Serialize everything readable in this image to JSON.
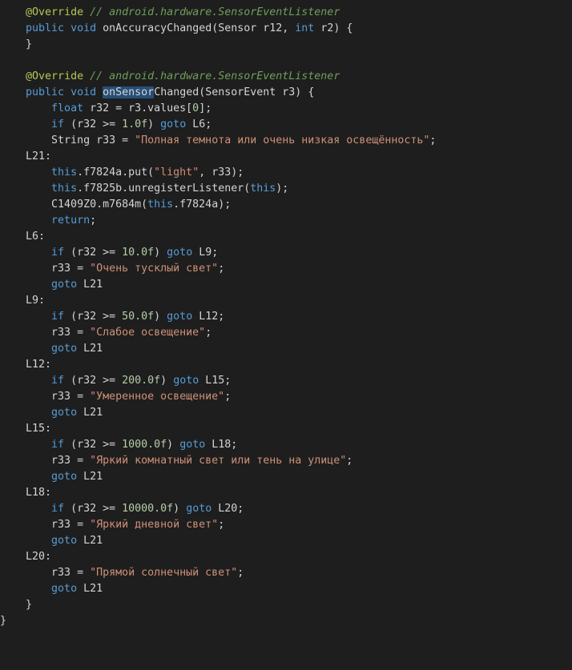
{
  "editor": {
    "theme": {
      "background": "#1e1e1e",
      "keyword": "#569cd6",
      "string": "#ce9178",
      "number": "#b5cea8",
      "comment": "#6f9e5c",
      "annotation": "#b5c953",
      "text": "#d4d4d4",
      "selection": "#264f78"
    },
    "lines": [
      [
        {
          "t": "    "
        },
        {
          "t": "@Override",
          "c": "ann"
        },
        {
          "t": " "
        },
        {
          "t": "// android.hardware.SensorEventListener",
          "c": "cmt"
        }
      ],
      [
        {
          "t": "    "
        },
        {
          "t": "public",
          "c": "kw"
        },
        {
          "t": " "
        },
        {
          "t": "void",
          "c": "kw"
        },
        {
          "t": " onAccuracyChanged(Sensor r12, "
        },
        {
          "t": "int",
          "c": "kw"
        },
        {
          "t": " r2) {"
        }
      ],
      [
        {
          "t": "    }"
        }
      ],
      [
        {
          "t": ""
        }
      ],
      [
        {
          "t": "    "
        },
        {
          "t": "@Override",
          "c": "ann"
        },
        {
          "t": " "
        },
        {
          "t": "// android.hardware.SensorEventListener",
          "c": "cmt"
        }
      ],
      [
        {
          "t": "    "
        },
        {
          "t": "public",
          "c": "kw"
        },
        {
          "t": " "
        },
        {
          "t": "void",
          "c": "kw"
        },
        {
          "t": " "
        },
        {
          "t": "onSensor",
          "c": "sel"
        },
        {
          "t": "Changed(SensorEvent r3) {"
        }
      ],
      [
        {
          "t": "        "
        },
        {
          "t": "float",
          "c": "kw"
        },
        {
          "t": " r32 = r3.values["
        },
        {
          "t": "0",
          "c": "num"
        },
        {
          "t": "];"
        }
      ],
      [
        {
          "t": "        "
        },
        {
          "t": "if",
          "c": "kw"
        },
        {
          "t": " (r32 >= "
        },
        {
          "t": "1.0f",
          "c": "num"
        },
        {
          "t": ") "
        },
        {
          "t": "goto",
          "c": "kw"
        },
        {
          "t": " L6;"
        }
      ],
      [
        {
          "t": "        String r33 = "
        },
        {
          "t": "\"Полная темнота или очень низкая освещённость\"",
          "c": "str"
        },
        {
          "t": ";"
        }
      ],
      [
        {
          "t": "    L21:"
        }
      ],
      [
        {
          "t": "        "
        },
        {
          "t": "this",
          "c": "kw"
        },
        {
          "t": ".f7824a.put("
        },
        {
          "t": "\"light\"",
          "c": "str"
        },
        {
          "t": ", r33);"
        }
      ],
      [
        {
          "t": "        "
        },
        {
          "t": "this",
          "c": "kw"
        },
        {
          "t": ".f7825b.unregisterListener("
        },
        {
          "t": "this",
          "c": "kw"
        },
        {
          "t": ");"
        }
      ],
      [
        {
          "t": "        C1409Z0.m7684m("
        },
        {
          "t": "this",
          "c": "kw"
        },
        {
          "t": ".f7824a);"
        }
      ],
      [
        {
          "t": "        "
        },
        {
          "t": "return",
          "c": "kw"
        },
        {
          "t": ";"
        }
      ],
      [
        {
          "t": "    L6:"
        }
      ],
      [
        {
          "t": "        "
        },
        {
          "t": "if",
          "c": "kw"
        },
        {
          "t": " (r32 >= "
        },
        {
          "t": "10.0f",
          "c": "num"
        },
        {
          "t": ") "
        },
        {
          "t": "goto",
          "c": "kw"
        },
        {
          "t": " L9;"
        }
      ],
      [
        {
          "t": "        r33 = "
        },
        {
          "t": "\"Очень тусклый свет\"",
          "c": "str"
        },
        {
          "t": ";"
        }
      ],
      [
        {
          "t": "        "
        },
        {
          "t": "goto",
          "c": "kw"
        },
        {
          "t": " L21"
        }
      ],
      [
        {
          "t": "    L9:"
        }
      ],
      [
        {
          "t": "        "
        },
        {
          "t": "if",
          "c": "kw"
        },
        {
          "t": " (r32 >= "
        },
        {
          "t": "50.0f",
          "c": "num"
        },
        {
          "t": ") "
        },
        {
          "t": "goto",
          "c": "kw"
        },
        {
          "t": " L12;"
        }
      ],
      [
        {
          "t": "        r33 = "
        },
        {
          "t": "\"Слабое освещение\"",
          "c": "str"
        },
        {
          "t": ";"
        }
      ],
      [
        {
          "t": "        "
        },
        {
          "t": "goto",
          "c": "kw"
        },
        {
          "t": " L21"
        }
      ],
      [
        {
          "t": "    L12:"
        }
      ],
      [
        {
          "t": "        "
        },
        {
          "t": "if",
          "c": "kw"
        },
        {
          "t": " (r32 >= "
        },
        {
          "t": "200.0f",
          "c": "num"
        },
        {
          "t": ") "
        },
        {
          "t": "goto",
          "c": "kw"
        },
        {
          "t": " L15;"
        }
      ],
      [
        {
          "t": "        r33 = "
        },
        {
          "t": "\"Умеренное освещение\"",
          "c": "str"
        },
        {
          "t": ";"
        }
      ],
      [
        {
          "t": "        "
        },
        {
          "t": "goto",
          "c": "kw"
        },
        {
          "t": " L21"
        }
      ],
      [
        {
          "t": "    L15:"
        }
      ],
      [
        {
          "t": "        "
        },
        {
          "t": "if",
          "c": "kw"
        },
        {
          "t": " (r32 >= "
        },
        {
          "t": "1000.0f",
          "c": "num"
        },
        {
          "t": ") "
        },
        {
          "t": "goto",
          "c": "kw"
        },
        {
          "t": " L18;"
        }
      ],
      [
        {
          "t": "        r33 = "
        },
        {
          "t": "\"Яркий комнатный свет или тень на улице\"",
          "c": "str"
        },
        {
          "t": ";"
        }
      ],
      [
        {
          "t": "        "
        },
        {
          "t": "goto",
          "c": "kw"
        },
        {
          "t": " L21"
        }
      ],
      [
        {
          "t": "    L18:"
        }
      ],
      [
        {
          "t": "        "
        },
        {
          "t": "if",
          "c": "kw"
        },
        {
          "t": " (r32 >= "
        },
        {
          "t": "10000.0f",
          "c": "num"
        },
        {
          "t": ") "
        },
        {
          "t": "goto",
          "c": "kw"
        },
        {
          "t": " L20;"
        }
      ],
      [
        {
          "t": "        r33 = "
        },
        {
          "t": "\"Яркий дневной свет\"",
          "c": "str"
        },
        {
          "t": ";"
        }
      ],
      [
        {
          "t": "        "
        },
        {
          "t": "goto",
          "c": "kw"
        },
        {
          "t": " L21"
        }
      ],
      [
        {
          "t": "    L20:"
        }
      ],
      [
        {
          "t": "        r33 = "
        },
        {
          "t": "\"Прямой солнечный свет\"",
          "c": "str"
        },
        {
          "t": ";"
        }
      ],
      [
        {
          "t": "        "
        },
        {
          "t": "goto",
          "c": "kw"
        },
        {
          "t": " L21"
        }
      ],
      [
        {
          "t": "    }"
        }
      ],
      [
        {
          "t": "}"
        }
      ]
    ]
  }
}
